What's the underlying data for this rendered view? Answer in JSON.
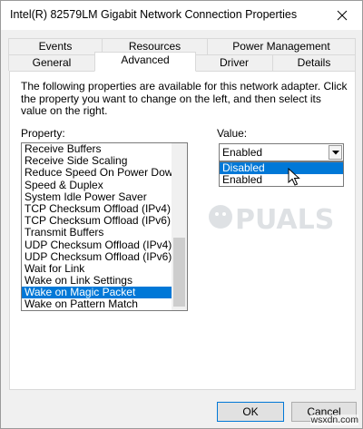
{
  "window": {
    "title": "Intel(R) 82579LM Gigabit Network Connection Properties"
  },
  "tabs": {
    "row1": [
      "Events",
      "Resources",
      "Power Management"
    ],
    "row2": [
      "General",
      "Advanced",
      "Driver",
      "Details"
    ],
    "active": "Advanced"
  },
  "advanced": {
    "description": "The following properties are available for this network adapter. Click the property you want to change on the left, and then select its value on the right.",
    "property_label": "Property:",
    "value_label": "Value:",
    "properties": [
      "Receive Buffers",
      "Receive Side Scaling",
      "Reduce Speed On Power Down",
      "Speed & Duplex",
      "System Idle Power Saver",
      "TCP Checksum Offload (IPv4)",
      "TCP Checksum Offload (IPv6)",
      "Transmit Buffers",
      "UDP Checksum Offload (IPv4)",
      "UDP Checksum Offload (IPv6)",
      "Wait for Link",
      "Wake on Link Settings",
      "Wake on Magic Packet",
      "Wake on Pattern Match"
    ],
    "selected_property": "Wake on Magic Packet",
    "value_selected": "Enabled",
    "value_options": [
      "Disabled",
      "Enabled"
    ],
    "value_highlighted": "Disabled"
  },
  "buttons": {
    "ok": "OK",
    "cancel": "Cancel"
  },
  "watermark": {
    "logo_text": "A  PUALS"
  },
  "footer": {
    "site": "wsxdn.com"
  },
  "colors": {
    "selection": "#0078d7",
    "dialog_bg": "#f0f0f0"
  },
  "icons": [
    "close-icon",
    "chevron-down-icon",
    "mouse-cursor-icon"
  ]
}
